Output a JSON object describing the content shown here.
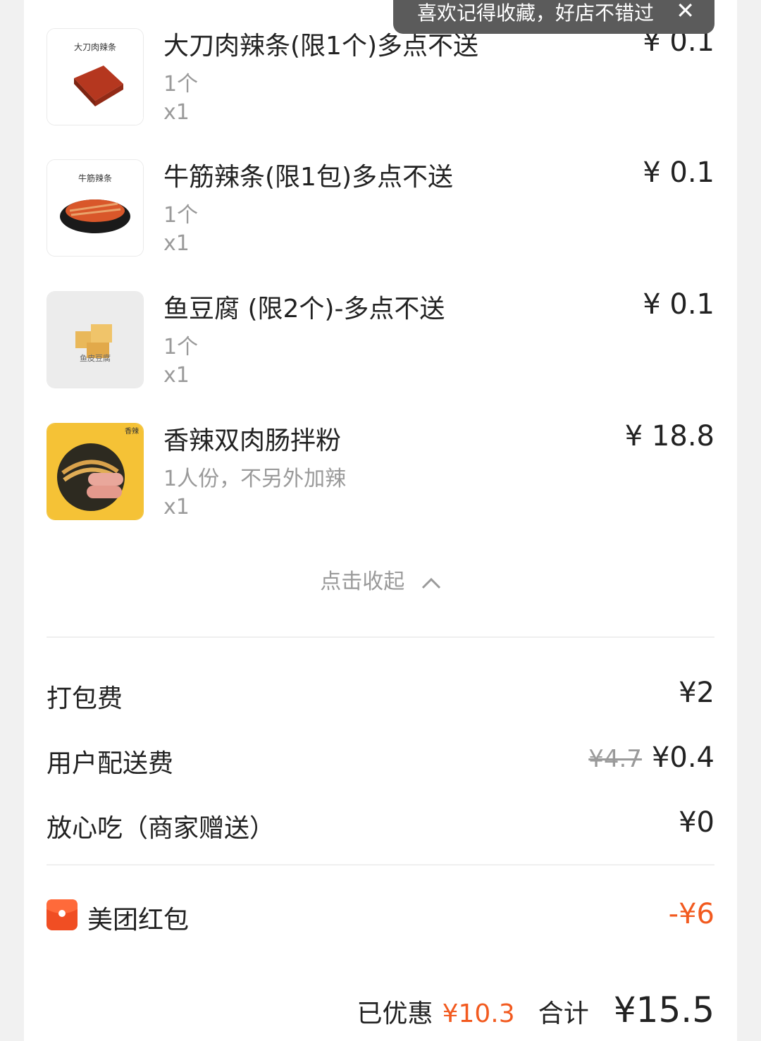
{
  "toast": {
    "text": "喜欢记得收藏，好店不错过",
    "close": "✕"
  },
  "items": [
    {
      "name": "大刀肉辣条(限1个)多点不送",
      "spec": "1个",
      "qty": "x1",
      "price": "¥ 0.1",
      "thumb_label": "大刀肉辣条"
    },
    {
      "name": "牛筋辣条(限1包)多点不送",
      "spec": "1个",
      "qty": "x1",
      "price": "¥ 0.1",
      "thumb_label": "牛筋辣条"
    },
    {
      "name": "鱼豆腐 (限2个)-多点不送",
      "spec": "1个",
      "qty": "x1",
      "price": "¥ 0.1",
      "thumb_label": "鱼皮豆腐"
    },
    {
      "name": "香辣双肉肠拌粉",
      "spec": "1人份，不另外加辣",
      "qty": "x1",
      "price": "¥ 18.8",
      "thumb_label": "香辣"
    }
  ],
  "collapse": {
    "label": "点击收起"
  },
  "fees": {
    "packing": {
      "label": "打包费",
      "value": "¥2"
    },
    "delivery": {
      "label": "用户配送费",
      "original": "¥4.7",
      "value": "¥0.4"
    },
    "assurance": {
      "label": "放心吃（商家赠送）",
      "value": "¥0"
    }
  },
  "redpacket": {
    "label": "美团红包",
    "value": "-¥6"
  },
  "summary": {
    "discount_label": "已优惠",
    "discount": "¥10.3",
    "total_label": "合计",
    "total": "¥15.5"
  },
  "colors": {
    "accent": "#f25a1f",
    "muted": "#9a9a9a",
    "toast_bg": "#5b5b5b"
  }
}
